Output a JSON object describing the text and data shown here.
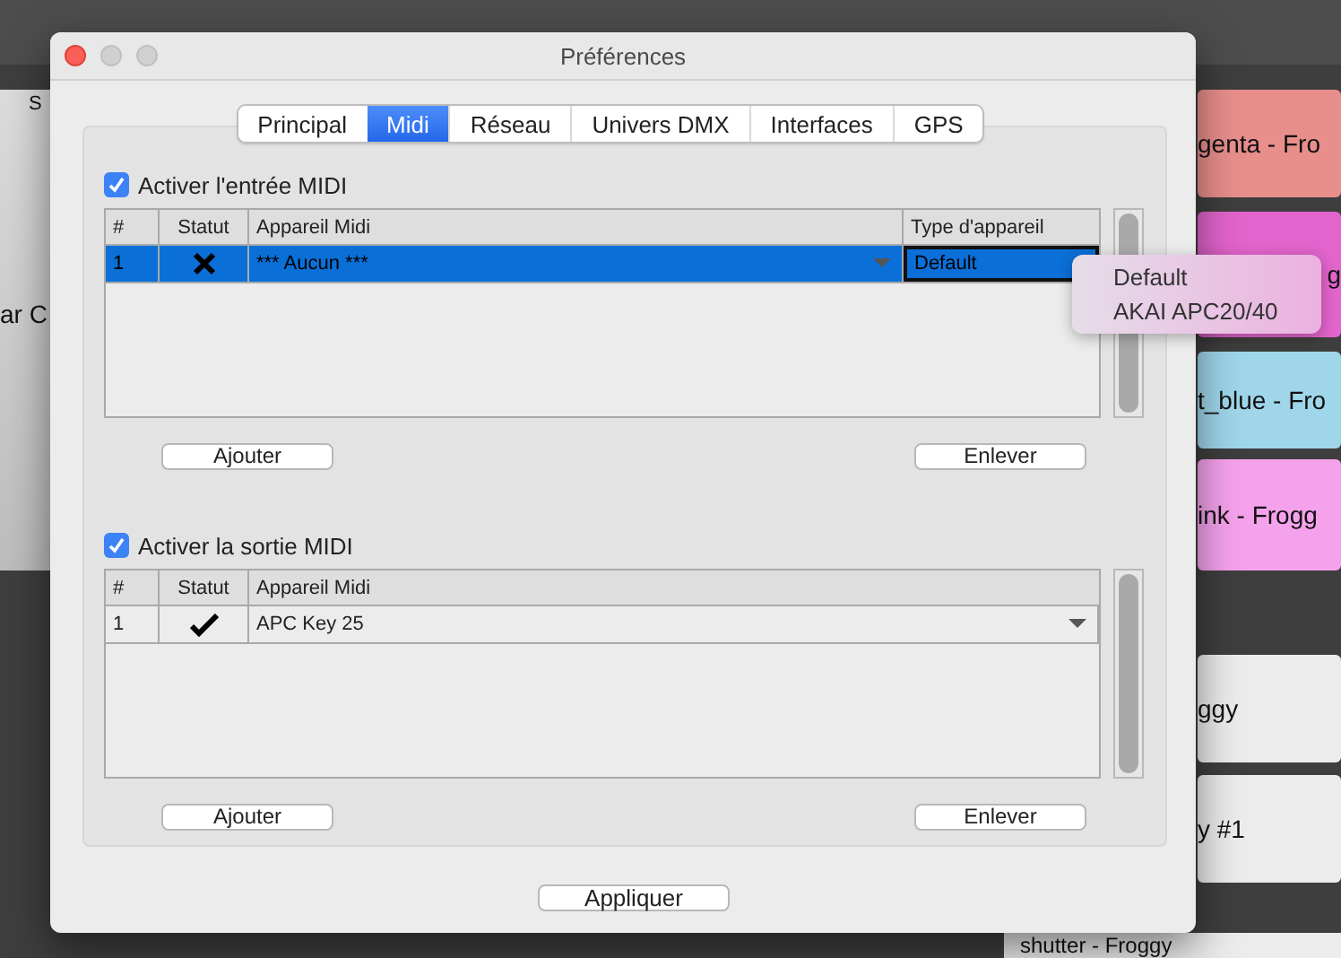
{
  "background_app": {
    "left_tiles": [
      {
        "label": "S"
      },
      {
        "label": "ar C"
      }
    ],
    "right_tiles": [
      {
        "label": "genta - Fro",
        "color": "#e88f8c"
      },
      {
        "label": "g",
        "color": "#e264cc"
      },
      {
        "label": "t_blue - Fro",
        "color": "#9fd6ea"
      },
      {
        "label": "ink - Frogg",
        "color": "#f5a2ec"
      },
      {
        "label": "ggy",
        "color": "#ececec"
      },
      {
        "label": "y #1",
        "color": "#ececec"
      },
      {
        "label": "shutter - Froggy",
        "color": "#ececec"
      }
    ]
  },
  "window": {
    "title": "Préférences"
  },
  "tabs": [
    {
      "label": "Principal",
      "selected": false
    },
    {
      "label": "Midi",
      "selected": true
    },
    {
      "label": "Réseau",
      "selected": false
    },
    {
      "label": "Univers DMX",
      "selected": false
    },
    {
      "label": "Interfaces",
      "selected": false
    },
    {
      "label": "GPS",
      "selected": false
    }
  ],
  "sections": [
    {
      "checkbox": {
        "label": "Activer l'entrée MIDI",
        "checked": true
      },
      "table": {
        "columns": [
          "#",
          "Statut",
          "Appareil Midi",
          "Type d'appareil"
        ],
        "rows": [
          {
            "number": "1",
            "kind": "cross",
            "device": "*** Aucun ***",
            "type": "Default",
            "selected": true
          }
        ]
      },
      "buttons": [
        "Ajouter",
        "Enlever"
      ]
    },
    {
      "checkbox": {
        "label": "Activer la sortie MIDI",
        "checked": true
      },
      "table": {
        "columns": [
          "#",
          "Statut",
          "Appareil Midi"
        ],
        "rows": [
          {
            "number": "1",
            "kind": "check",
            "device": "APC Key 25",
            "selected": false
          }
        ]
      },
      "buttons": [
        "Ajouter",
        "Enlever"
      ]
    }
  ],
  "apply_button": "Appliquer",
  "dropdown_menu": {
    "options": [
      "Default",
      "AKAI APC20/40"
    ]
  }
}
